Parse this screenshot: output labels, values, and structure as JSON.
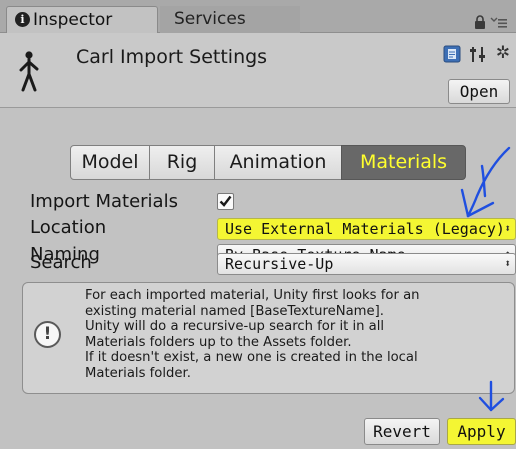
{
  "tabs": {
    "inspector_label": "Inspector",
    "services_label": "Services",
    "info_glyph": "i",
    "icons": [
      "info-icon",
      "lock-icon",
      "menu-icon"
    ]
  },
  "header": {
    "title": "Carl Import Settings",
    "open_label": "Open",
    "icons": [
      "humanoid-avatar-icon",
      "book-icon",
      "preset-sliders-icon",
      "gear-icon"
    ]
  },
  "segments": [
    {
      "label": "Model",
      "selected": false
    },
    {
      "label": "Rig",
      "selected": false
    },
    {
      "label": "Animation",
      "selected": false
    },
    {
      "label": "Materials",
      "selected": true
    }
  ],
  "fields": {
    "import_materials": {
      "label": "Import Materials",
      "checked": true,
      "check_glyph": "✓"
    },
    "location": {
      "label": "Location",
      "value": "Use External Materials (Legacy)",
      "highlighted": true
    },
    "naming": {
      "label": "Naming",
      "value": "By Base Texture Name"
    },
    "search": {
      "label": "Search",
      "value": "Recursive-Up"
    }
  },
  "help": {
    "icon_glyph": "!",
    "lines": [
      "For each imported material, Unity first looks for an",
      "existing material named [BaseTextureName].",
      "Unity will do a recursive-up search for it in all",
      "Materials folders up to the Assets folder.",
      "If it doesn't exist, a new one is created in the local",
      "Materials folder."
    ]
  },
  "footer": {
    "revert_label": "Revert",
    "apply_label": "Apply"
  },
  "dropdown_caret": "⬍",
  "colors": {
    "highlight_yellow": "#f4f633",
    "annotation_blue": "#1f4fe0",
    "selected_tab_bg": "#686868",
    "panel_bg": "#c2c2c2"
  }
}
